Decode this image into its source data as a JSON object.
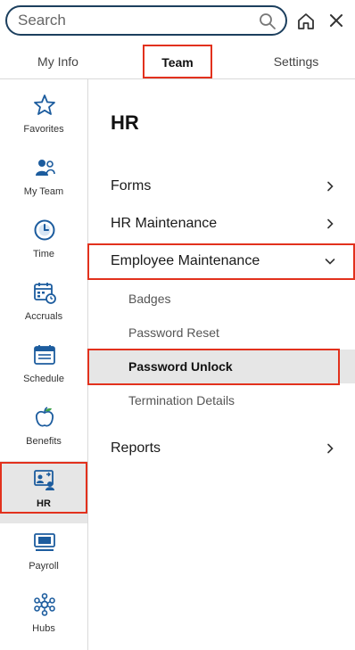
{
  "search": {
    "placeholder": "Search",
    "value": ""
  },
  "tabs": [
    {
      "label": "My Info",
      "active": false
    },
    {
      "label": "Team",
      "active": true
    },
    {
      "label": "Settings",
      "active": false
    }
  ],
  "sidebar": {
    "items": [
      {
        "label": "Favorites",
        "icon": "star-icon"
      },
      {
        "label": "My Team",
        "icon": "team-icon"
      },
      {
        "label": "Time",
        "icon": "clock-icon"
      },
      {
        "label": "Accruals",
        "icon": "calendar-clock-icon"
      },
      {
        "label": "Schedule",
        "icon": "calendar-icon"
      },
      {
        "label": "Benefits",
        "icon": "apple-icon"
      },
      {
        "label": "HR",
        "icon": "hr-icon",
        "active": true
      },
      {
        "label": "Payroll",
        "icon": "payroll-icon"
      },
      {
        "label": "Hubs",
        "icon": "hubs-icon"
      }
    ]
  },
  "main": {
    "title": "HR",
    "rows": [
      {
        "label": "Forms",
        "chevron": "right"
      },
      {
        "label": "HR Maintenance",
        "chevron": "right"
      },
      {
        "label": "Employee Maintenance",
        "chevron": "down",
        "expanded": true
      },
      {
        "label": "Reports",
        "chevron": "right"
      }
    ],
    "subitems": [
      {
        "label": "Badges"
      },
      {
        "label": "Password Reset"
      },
      {
        "label": "Password Unlock",
        "active": true
      },
      {
        "label": "Termination Details"
      }
    ]
  },
  "colors": {
    "icon_primary": "#1c5c9e",
    "highlight": "#e2311d",
    "active_bg": "#e6e6e6",
    "search_border": "#1c3f5e"
  }
}
